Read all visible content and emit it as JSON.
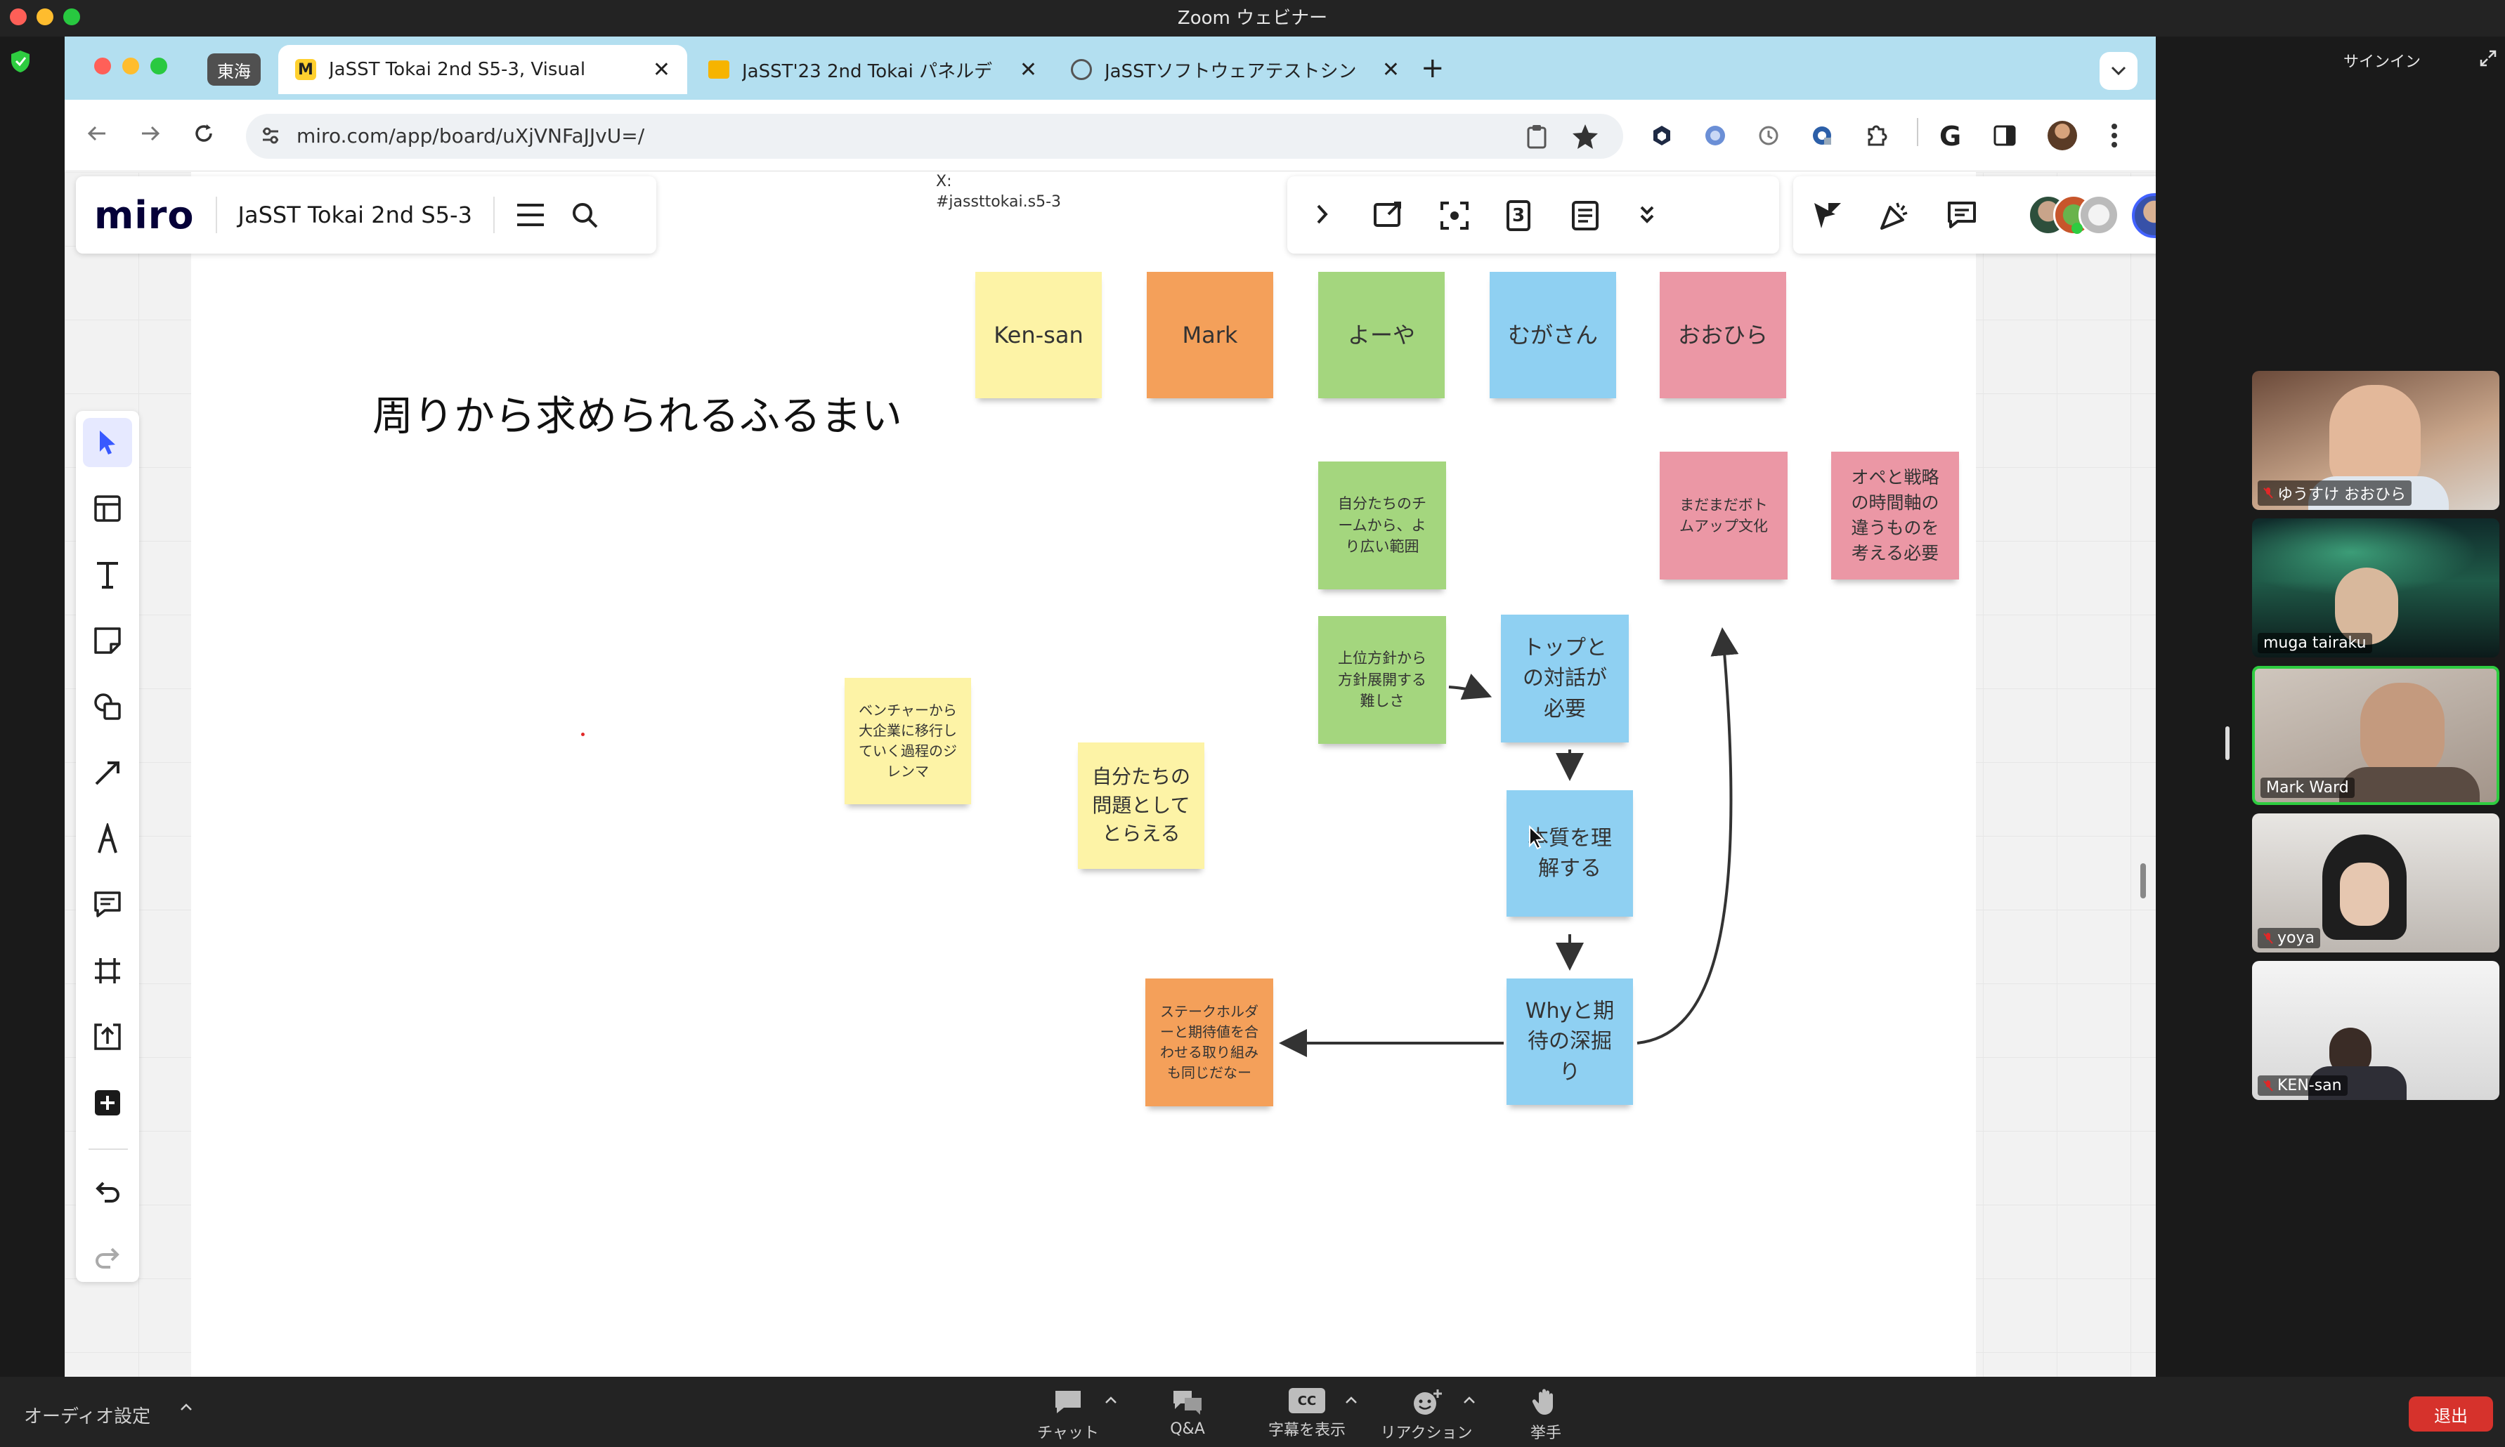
{
  "zoom": {
    "window_title": "Zoom ウェビナー",
    "signin": "サインイン",
    "audio_settings": "オーディオ設定",
    "leave": "退出",
    "bottom_buttons": [
      {
        "label": "チャット",
        "icon": "chat-icon"
      },
      {
        "label": "Q&A",
        "icon": "qa-icon"
      },
      {
        "label": "字幕を表示",
        "icon": "cc-icon",
        "icon_text": "CC"
      },
      {
        "label": "リアクション",
        "icon": "reaction-icon"
      },
      {
        "label": "挙手",
        "icon": "raise-hand-icon"
      }
    ],
    "participants": [
      {
        "name": "ゆうすけ おおひら",
        "muted": true,
        "active": false
      },
      {
        "name": "muga tairaku",
        "muted": false,
        "active": false
      },
      {
        "name": "Mark Ward",
        "muted": false,
        "active": true
      },
      {
        "name": "yoya",
        "muted": true,
        "active": false
      },
      {
        "name": "KEN-san",
        "muted": true,
        "active": false
      }
    ]
  },
  "browser": {
    "tab_group_label": "東海",
    "tabs": [
      {
        "title": "JaSST Tokai 2nd S5-3, Visual",
        "active": true
      },
      {
        "title": "JaSST'23 2nd Tokai パネルデ",
        "active": false
      },
      {
        "title": "JaSSTソフトウェアテストシン",
        "active": false
      }
    ],
    "url": "miro.com/app/board/uXjVNFaJJvU=/"
  },
  "miro": {
    "logo": "miro",
    "board_name": "JaSST Tokai 2nd S5-3",
    "top_note": "X:\n#jassttokai.s5-3",
    "timer_value": "3",
    "colors": {
      "yellow": "#fdf3a6",
      "orange": "#f4a05a",
      "green": "#a4d67e",
      "blue": "#8fd0f2",
      "pink": "#eb97a5",
      "accent": "#4262ff"
    },
    "heading": "周りから求められるふるまい",
    "header_stickies": [
      {
        "text": "Ken-san",
        "color": "yellow"
      },
      {
        "text": "Mark",
        "color": "orange"
      },
      {
        "text": "よーや",
        "color": "green"
      },
      {
        "text": "むがさん",
        "color": "blue"
      },
      {
        "text": "おおひら",
        "color": "pink"
      }
    ],
    "notes": {
      "green1": "自分たちのチームから、より広い範囲",
      "green2": "上位方針から方針展開する難しさ",
      "pink1": "まだまだボトムアップ文化",
      "pink2": "オペと戦略の時間軸の違うものを考える必要",
      "yellow1": "ベンチャーから大企業に移行していく過程のジレンマ",
      "yellow2": "自分たちの問題としてとらえる",
      "blue1": "トップとの対話が必要",
      "blue2": "本質を理解する",
      "blue3": "Whyと期待の深掘り",
      "orange1": "ステークホルダーと期待値を合わせる取り組みも同じだなー"
    }
  }
}
